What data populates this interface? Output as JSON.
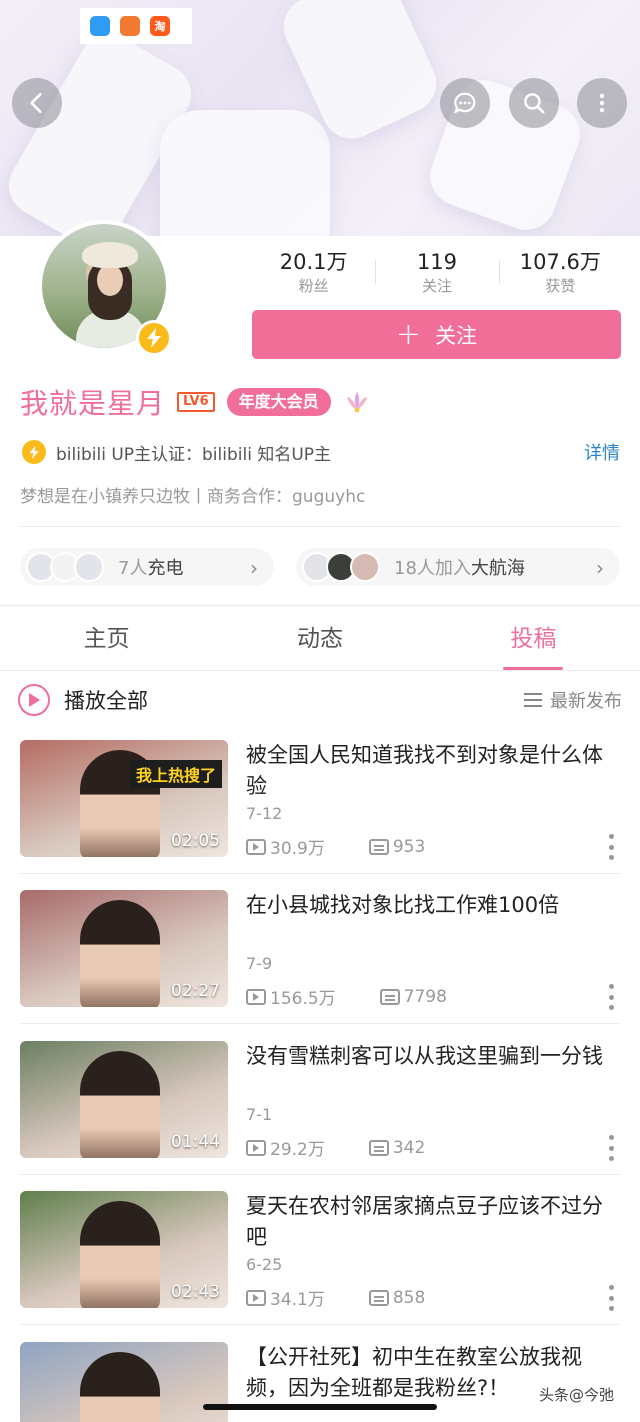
{
  "status_icons": [
    {
      "name": "app-icon-blue",
      "color": "#2f9bf3",
      "glyph": ""
    },
    {
      "name": "app-icon-orange",
      "color": "#f27a30",
      "glyph": ""
    },
    {
      "name": "taobao-icon",
      "color": "#ff5a1c",
      "glyph": "淘"
    }
  ],
  "profile": {
    "name": "我就是星月",
    "level": "LV6",
    "vip_badge": "年度大会员",
    "stats": [
      {
        "value": "20.1万",
        "label": "粉丝"
      },
      {
        "value": "119",
        "label": "关注"
      },
      {
        "value": "107.6万",
        "label": "获赞"
      }
    ],
    "follow_label": "关注",
    "certification": "bilibili UP主认证：bilibili 知名UP主",
    "cert_more": "详情",
    "bio": "梦想是在小镇养只边牧丨商务合作：guguyhc",
    "charge": {
      "count_text": "7人",
      "label": "充电"
    },
    "voyage": {
      "count_text": "18人加入",
      "label": "大航海"
    }
  },
  "tabs": [
    "主页",
    "动态",
    "投稿"
  ],
  "active_tab": 2,
  "list_header": {
    "play_all": "播放全部",
    "sort": "最新发布"
  },
  "videos": [
    {
      "title": "被全国人民知道我找不到对象是什么体验",
      "date": "7-12",
      "views": "30.9万",
      "danmaku": "953",
      "duration": "02:05",
      "tag": "我上热搜了",
      "thumb_color": "#b56c63"
    },
    {
      "title": "在小县城找对象比找工作难100倍",
      "date": "7-9",
      "views": "156.5万",
      "danmaku": "7798",
      "duration": "02:27",
      "tag": "",
      "thumb_color": "#a86b6b"
    },
    {
      "title": "没有雪糕刺客可以从我这里骗到一分钱",
      "date": "7-1",
      "views": "29.2万",
      "danmaku": "342",
      "duration": "01:44",
      "tag": "",
      "thumb_color": "#6b7f62"
    },
    {
      "title": "夏天在农村邻居家摘点豆子应该不过分吧",
      "date": "6-25",
      "views": "34.1万",
      "danmaku": "858",
      "duration": "02:43",
      "tag": "",
      "thumb_color": "#5f7f4c"
    },
    {
      "title": "【公开社死】初中生在教室公放我视频，因为全班都是我粉丝?！",
      "date": "",
      "views": "",
      "danmaku": "",
      "duration": "",
      "tag": "",
      "thumb_color": "#8fa4c2"
    }
  ],
  "watermark": "头条@今弛",
  "colors": {
    "accent": "#f06f9a",
    "link": "#2d84c8",
    "level": "#f35b2e",
    "bolt": "#fbbb1a"
  }
}
